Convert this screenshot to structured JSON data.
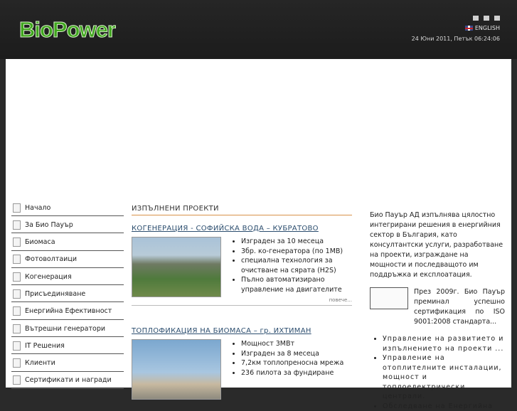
{
  "header": {
    "logo": "BioPower",
    "language": "ENGLISH",
    "datetime": "24 Юни 2011, Петък  06:24:06",
    "icons": [
      "home-icon",
      "mail-icon",
      "sitemap-icon"
    ]
  },
  "menu": {
    "items": [
      {
        "label": "Начало"
      },
      {
        "label": "За Био Пауър"
      },
      {
        "label": "Биомаса"
      },
      {
        "label": "Фотоволтаици"
      },
      {
        "label": "Когенерация"
      },
      {
        "label": "Присъединяване"
      },
      {
        "label": "Енергийна Ефективност"
      },
      {
        "label": "Вътрешни генератори"
      },
      {
        "label": "IT Решения"
      },
      {
        "label": "Клиенти"
      },
      {
        "label": "Сертификати и награди"
      }
    ]
  },
  "projects": {
    "section_title": "ИЗПЪЛНЕНИ ПРОЕКТИ",
    "items": [
      {
        "title": "КОГЕНЕРАЦИЯ - СОФИЙСКА ВОДА – КУБРАТОВО",
        "bullets": [
          "Изграден за 10 месеца",
          "3бр. ко-генератора (по 1MB)",
          "специална технология за очистване на сярата (H2S)",
          "Пълно автоматизирано управление на двигателите"
        ],
        "more": "повече..."
      },
      {
        "title": "ТОПЛОФИКАЦИЯ НА БИОМАСА – гр. ИХТИМАН",
        "bullets": [
          "Мощност 3МВт",
          "Изграден за 8 месеца",
          "7,2км топлопреносна мрежа",
          "236 пилота за фундиране"
        ]
      }
    ]
  },
  "about": {
    "intro": "Био Пауър АД изпълнява цялостно интегрирани решения в енергийния сектор в България, като консултантски услуги, разработване на проекти, изграждане на мощности и последващото им поддръжка и експлоатация.",
    "cert_text": "През 2009г. Био Пауър преминал успешно сертификация по ISO 9001:2008 стандарта...",
    "services": [
      "Управление на развитието и изпълнението на проекти ...",
      "Управление на отоплителните инсталации, мощност и топлоелектрически централи.",
      "Обследване на Енергийна"
    ]
  }
}
